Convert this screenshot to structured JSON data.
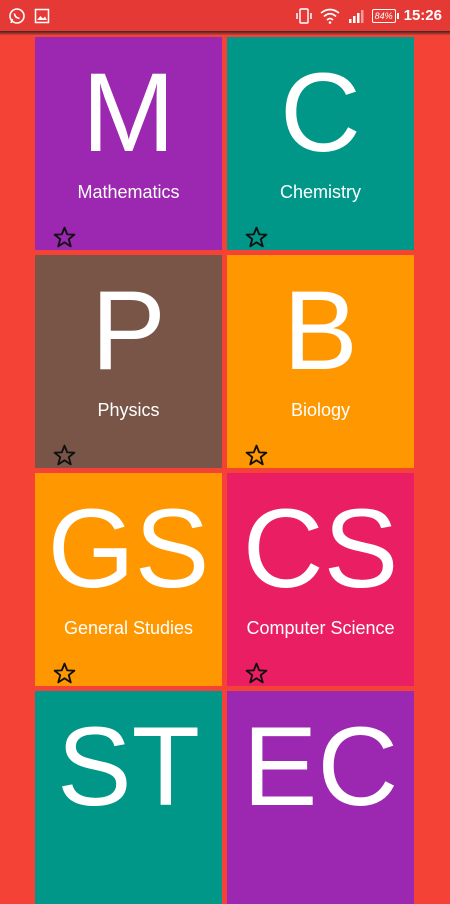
{
  "status_bar": {
    "time": "15:26",
    "battery": "84%",
    "icons": [
      "whatsapp-icon",
      "gallery-icon",
      "vibrate-icon",
      "wifi-icon",
      "signal-icon",
      "battery-icon"
    ]
  },
  "subjects": [
    {
      "letter": "M",
      "name": "Mathematics",
      "color": "#9c27b0"
    },
    {
      "letter": "C",
      "name": "Chemistry",
      "color": "#009688"
    },
    {
      "letter": "P",
      "name": "Physics",
      "color": "#795548"
    },
    {
      "letter": "B",
      "name": "Biology",
      "color": "#ff9800"
    },
    {
      "letter": "GS",
      "name": "General Studies",
      "color": "#ff9800"
    },
    {
      "letter": "CS",
      "name": "Computer Science",
      "color": "#e91e63"
    },
    {
      "letter": "ST",
      "name": "",
      "color": "#009688"
    },
    {
      "letter": "EC",
      "name": "",
      "color": "#9c27b0"
    }
  ],
  "colors": {
    "background": "#f44336",
    "status_bar": "#e53935"
  }
}
